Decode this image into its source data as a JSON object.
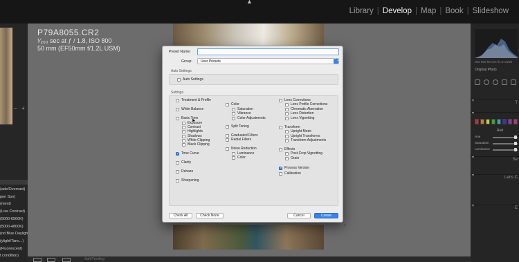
{
  "topbar": {
    "caret": "▲",
    "modules": [
      "Library",
      "Develop",
      "Map",
      "Book",
      "Slideshow"
    ],
    "active_module": "Develop"
  },
  "photo_meta": {
    "filename": "P79A8055.CR2",
    "exposure": "¹⁄₂₀₀ sec at ƒ / 1.8, ISO 800",
    "lens": "50 mm (EF50mm f/1.2L USM)"
  },
  "left_panel": {
    "minus": "–",
    "plus": "+",
    "presets": [
      "(ade/Overcast)",
      "pen Sun)",
      "(ment)",
      "(Low Contrast)",
      "(5000-6500K)",
      "(5000-4800K)",
      "(nd Blue Daylight)",
      "(ylight/Tanc...)",
      "(Fluorescent)",
      "t condition)"
    ]
  },
  "right_panel": {
    "histogram_info": "ISO 800   50 mm   f/1.8   1/200",
    "original_photo": "Original Photo",
    "hsl_title": "Red",
    "sliders": [
      {
        "label": "Hue"
      },
      {
        "label": "Saturation"
      },
      {
        "label": "Luminance"
      }
    ],
    "sections": [
      "T",
      "Se",
      "Lens C",
      "E"
    ],
    "swatch_colors": [
      "#b33",
      "#c73",
      "#cc3",
      "#3a3",
      "#3aa",
      "#33b",
      "#93a",
      "#b37"
    ]
  },
  "dialog": {
    "preset_name_label": "Preset Name:",
    "preset_name_value": "",
    "group_label": "Group:",
    "group_value": "User Presets",
    "auto_settings_title": "Auto Settings",
    "auto_settings_checkbox": "Auto Settings",
    "settings_title": "Settings",
    "col1": [
      {
        "label": "Treatment & Profile",
        "checked": false
      },
      {
        "label": "White Balance",
        "checked": false
      },
      {
        "label": "Basic Tone",
        "checked": false
      },
      {
        "label": "Exposure",
        "checked": false,
        "sub": true
      },
      {
        "label": "Contrast",
        "checked": false,
        "sub": true
      },
      {
        "label": "Highlights",
        "checked": false,
        "sub": true
      },
      {
        "label": "Shadows",
        "checked": false,
        "sub": true
      },
      {
        "label": "White Clipping",
        "checked": false,
        "sub": true
      },
      {
        "label": "Black Clipping",
        "checked": false,
        "sub": true
      },
      {
        "label": "Tone Curve",
        "checked": true
      },
      {
        "label": "Clarity",
        "checked": false
      },
      {
        "label": "Dehaze",
        "checked": false
      },
      {
        "label": "Sharpening",
        "checked": false
      }
    ],
    "col2": [
      {
        "label": "Color",
        "checked": false
      },
      {
        "label": "Saturation",
        "checked": false,
        "sub": true
      },
      {
        "label": "Vibrance",
        "checked": false,
        "sub": true
      },
      {
        "label": "Color Adjustments",
        "checked": false,
        "sub": true
      },
      {
        "label": "Split Toning",
        "checked": false
      },
      {
        "label": "Graduated Filters",
        "checked": false
      },
      {
        "label": "Radial Filters",
        "checked": false
      },
      {
        "label": "Noise Reduction",
        "checked": false
      },
      {
        "label": "Luminance",
        "checked": false,
        "sub": true
      },
      {
        "label": "Color",
        "checked": false,
        "sub": true
      }
    ],
    "col3": [
      {
        "label": "Lens Corrections",
        "checked": false
      },
      {
        "label": "Lens Profile Corrections",
        "checked": false,
        "sub": true
      },
      {
        "label": "Chromatic Aberration",
        "checked": false,
        "sub": true
      },
      {
        "label": "Lens Distortion",
        "checked": false,
        "sub": true
      },
      {
        "label": "Lens Vignetting",
        "checked": false,
        "sub": true
      },
      {
        "label": "Transform",
        "checked": false
      },
      {
        "label": "Upright Mode",
        "checked": false,
        "sub": true
      },
      {
        "label": "Upright Transforms",
        "checked": false,
        "sub": true
      },
      {
        "label": "Transform Adjustments",
        "checked": false,
        "sub": true
      },
      {
        "label": "Effects",
        "checked": false
      },
      {
        "label": "Post-Crop Vignetting",
        "checked": false,
        "sub": true
      },
      {
        "label": "Grain",
        "checked": false,
        "sub": true
      },
      {
        "label": "Process Version",
        "checked": true
      },
      {
        "label": "Calibration",
        "checked": false
      }
    ],
    "buttons": {
      "check_all": "Check All",
      "check_none": "Check None",
      "cancel": "Cancel",
      "create": "Create"
    }
  },
  "filmstrip": {
    "text": "Soft Proofing"
  }
}
